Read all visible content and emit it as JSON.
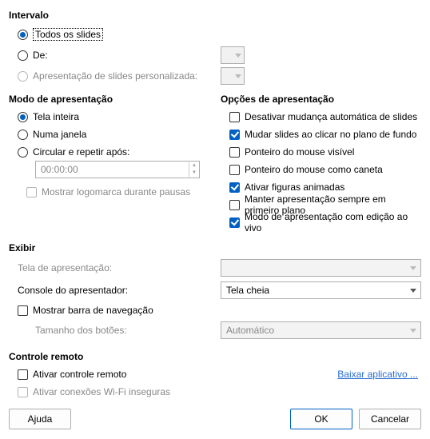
{
  "intervalo": {
    "title": "Intervalo",
    "opt_all": "Todos os slides",
    "opt_from": "De:",
    "opt_custom": "Apresentação de slides personalizada:"
  },
  "modo": {
    "title": "Modo de apresentação",
    "full": "Tela inteira",
    "window": "Numa janela",
    "loop": "Circular e repetir após:",
    "time": "00:00:00",
    "logo": "Mostrar logomarca durante pausas"
  },
  "opcoes": {
    "title": "Opções de apresentação",
    "c1": "Desativar mudança automática de slides",
    "c2": "Mudar slides ao clicar no plano de fundo",
    "c3": "Ponteiro do mouse visível",
    "c4": "Ponteiro do mouse como caneta",
    "c5": "Ativar figuras animadas",
    "c6": "Manter apresentação sempre em primeiro plano",
    "c7": "Modo de apresentação com edição ao vivo"
  },
  "exibir": {
    "title": "Exibir",
    "screen": "Tela de apresentação:",
    "console": "Console do apresentador:",
    "console_val": "Tela cheia",
    "navbar": "Mostrar barra de navegação",
    "btnsize": "Tamanho dos botões:",
    "btnsize_val": "Automático"
  },
  "remote": {
    "title": "Controle remoto",
    "enable": "Ativar controle remoto",
    "wifi": "Ativar conexões Wi-Fi inseguras",
    "link": "Baixar aplicativo ..."
  },
  "buttons": {
    "help": "Ajuda",
    "ok": "OK",
    "cancel": "Cancelar"
  }
}
